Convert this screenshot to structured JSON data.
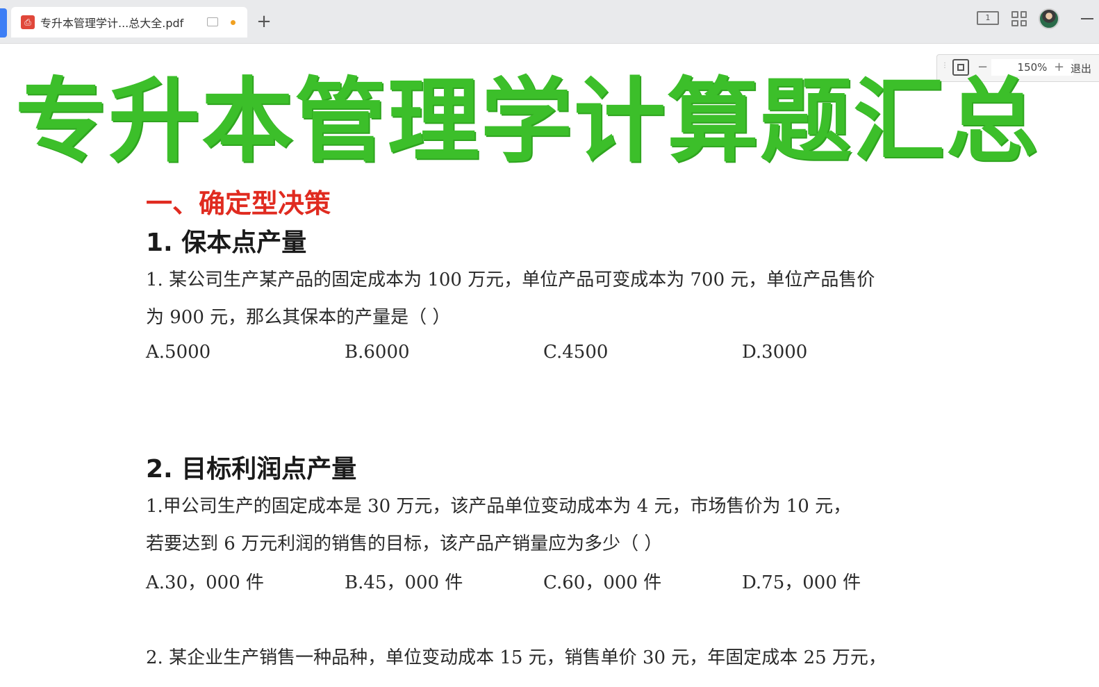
{
  "tab": {
    "title": "专升本管理学计...总大全.pdf",
    "icon": "pdf-icon",
    "new_tab_label": "+"
  },
  "window_controls": {
    "layout_label": "1",
    "avatar": "user-avatar"
  },
  "zoom": {
    "minus": "−",
    "value": "150%",
    "plus": "+",
    "exit_label": "退出"
  },
  "document": {
    "title": "专升本管理学计算题汇总",
    "section1": "一、确定型决策",
    "q1_heading": "1. 保本点产量",
    "q1_line1": "1. 某公司生产某产品的固定成本为  100  万元，单位产品可变成本为  700  元，单位产品售价",
    "q1_line2": "为  900  元，那么其保本的产量是（        ）",
    "q1_options": [
      "A.5000",
      "B.6000",
      "C.4500",
      "D.3000"
    ],
    "q2_heading": "2. 目标利润点产量",
    "q2_line1": "1.甲公司生产的固定成本是  30  万元，该产品单位变动成本为  4  元，市场售价为  10  元，",
    "q2_line2": "若要达到  6  万元利润的销售的目标，该产品产销量应为多少（        ）",
    "q2_options": [
      "A.30，000  件",
      "B.45，000  件",
      "C.60，000  件",
      "D.75，000  件"
    ],
    "q3_line1": "2. 某企业生产销售一种品种，单位变动成本  15  元，销售单价  30  元，年固定成本  25  万元，"
  },
  "colors": {
    "title_green": "#3cbf2a",
    "section_red": "#e02b20",
    "tab_accent": "#3d7ef5"
  }
}
